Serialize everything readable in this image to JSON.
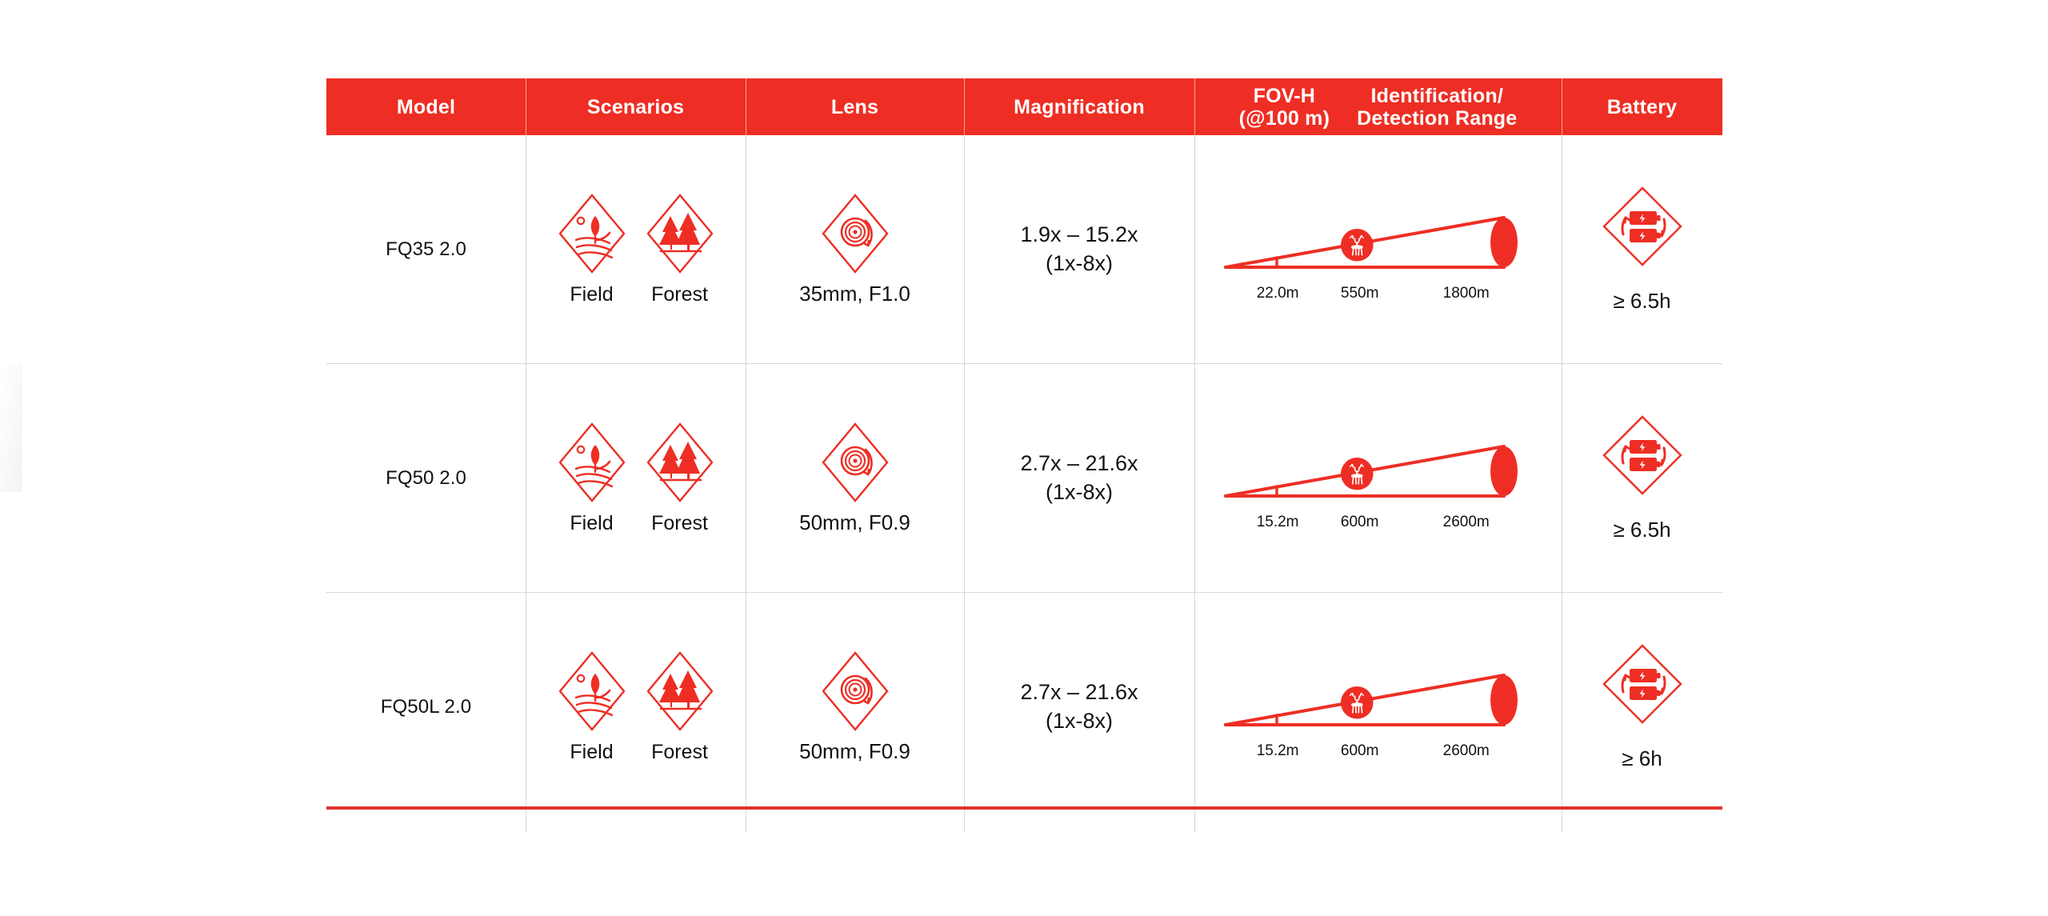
{
  "table": {
    "accent_color": "#ee2e24",
    "divider_color": "#d6d6d6",
    "text_color": "#15100f",
    "headers": {
      "model": "Model",
      "scenarios": "Scenarios",
      "lens": "Lens",
      "magnification": "Magnification",
      "fov_h_line1": "FOV-H",
      "fov_h_line2": "(@100 m)",
      "range_line1": "Identification/",
      "range_line2": "Detection Range",
      "battery": "Battery"
    },
    "rows": [
      {
        "model": "FQ35 2.0",
        "scenarios": [
          {
            "icon": "field-icon",
            "label": "Field"
          },
          {
            "icon": "forest-icon",
            "label": "Forest"
          }
        ],
        "lens_icon": "lens-aperture-icon",
        "lens": "35mm, F1.0",
        "magnification_line1": "1.9x – 15.2x",
        "magnification_line2": "(1x-8x)",
        "fov": {
          "fov_h": "22.0m",
          "identification": "550m",
          "detection": "1800m",
          "subject_icon": "deer-icon"
        },
        "battery_icon": "dual-battery-swap-icon",
        "battery": "≥ 6.5h"
      },
      {
        "model": "FQ50 2.0",
        "scenarios": [
          {
            "icon": "field-icon",
            "label": "Field"
          },
          {
            "icon": "forest-icon",
            "label": "Forest"
          }
        ],
        "lens_icon": "lens-aperture-icon",
        "lens": "50mm, F0.9",
        "magnification_line1": "2.7x – 21.6x",
        "magnification_line2": "(1x-8x)",
        "fov": {
          "fov_h": "15.2m",
          "identification": "600m",
          "detection": "2600m",
          "subject_icon": "deer-icon"
        },
        "battery_icon": "dual-battery-swap-icon",
        "battery": "≥ 6.5h"
      },
      {
        "model": "FQ50L 2.0",
        "scenarios": [
          {
            "icon": "field-icon",
            "label": "Field"
          },
          {
            "icon": "forest-icon",
            "label": "Forest"
          }
        ],
        "lens_icon": "lens-aperture-icon",
        "lens": "50mm, F0.9",
        "magnification_line1": "2.7x – 21.6x",
        "magnification_line2": "(1x-8x)",
        "fov": {
          "fov_h": "15.2m",
          "identification": "600m",
          "detection": "2600m",
          "subject_icon": "deer-icon"
        },
        "battery_icon": "dual-battery-swap-icon",
        "battery": "≥ 6h"
      }
    ]
  }
}
